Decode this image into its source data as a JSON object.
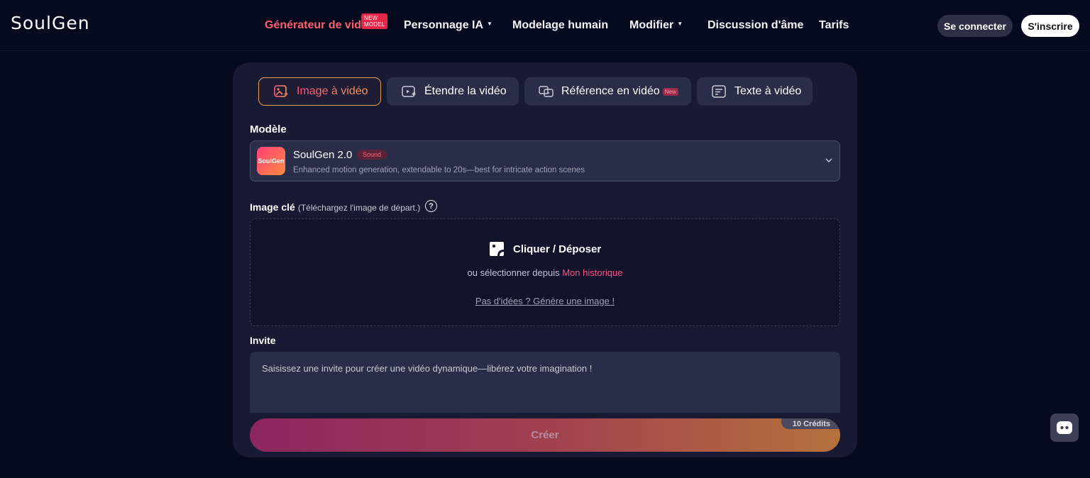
{
  "header": {
    "logo": "SoulGen",
    "nav": [
      {
        "label": "Générateur de vidéo",
        "active": true,
        "dropdown": true
      },
      {
        "label": "Personnage IA",
        "dropdown": true
      },
      {
        "label": "Modelage humain",
        "dropdown": false
      },
      {
        "label": "Modifier",
        "dropdown": true
      },
      {
        "label": "Discussion d'âme",
        "dropdown": false
      },
      {
        "label": "Tarifs",
        "dropdown": false
      }
    ],
    "new_model_badge": "NEW MODEL",
    "login": "Se connecter",
    "signup": "S'inscrire"
  },
  "tabs": [
    {
      "label": "Image à vidéo",
      "icon": "image-sparkle-icon",
      "active": true
    },
    {
      "label": "Étendre la vidéo",
      "icon": "video-extend-icon"
    },
    {
      "label": "Référence en vidéo",
      "icon": "reference-video-icon",
      "badge": "New"
    },
    {
      "label": "Texte à vidéo",
      "icon": "text-document-icon"
    }
  ],
  "model": {
    "label": "Modèle",
    "logo_text": "SoulGen",
    "name": "SoulGen 2.0",
    "badge": "Sound",
    "description": "Enhanced motion generation, extendable to 20s—best for intricate action scenes"
  },
  "key_image": {
    "label": "Image clé",
    "hint": "(Téléchargez l'image de départ.)",
    "drop_title": "Cliquer / Déposer",
    "select_prefix": "ou sélectionner depuis",
    "history_link": "Mon historique",
    "idea_link": "Pas d'idées ? Génère une image !"
  },
  "prompt": {
    "label": "Invite",
    "placeholder": "Saisissez une invite pour créer une vidéo dynamique—libérez votre imagination !"
  },
  "create": {
    "label": "Créer",
    "credits": "10 Crédits"
  },
  "colors": {
    "background": "#060a1f",
    "card": "#171a32",
    "accent_pink": "#ff4f86",
    "accent_orange": "#f79d5a"
  }
}
